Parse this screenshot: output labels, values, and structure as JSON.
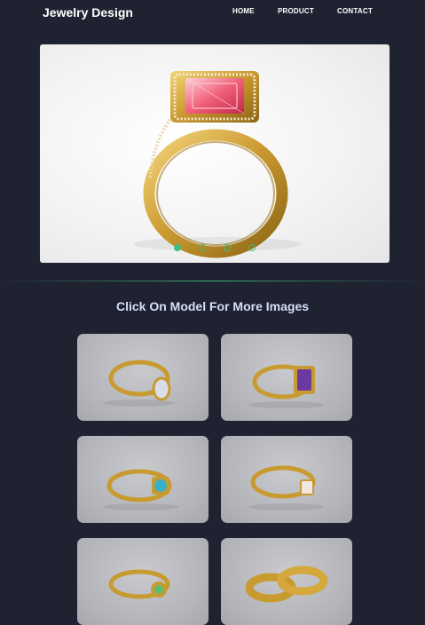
{
  "nav": {
    "brand": "Jewelry Design",
    "links": [
      "HOME",
      "PRODUCT",
      "CONTACT"
    ]
  },
  "hero": {
    "image": "ring-emerald-cut-pink-stone-halo-gold",
    "slides": 4,
    "active_slide": 1
  },
  "gallery": {
    "title": "Click On Model For More Images",
    "items": [
      "ring-oval-white-stone",
      "ring-emerald-cut-purple-stone-halo",
      "ring-blue-stone-halo-split-shank",
      "ring-cushion-clear-stone-pave",
      "ring-green-stone-cluster",
      "ring-pair-engraved-bands"
    ]
  },
  "colors": {
    "background": "#1f2230",
    "accent": "#3fbf7f",
    "title": "#d9defa"
  }
}
